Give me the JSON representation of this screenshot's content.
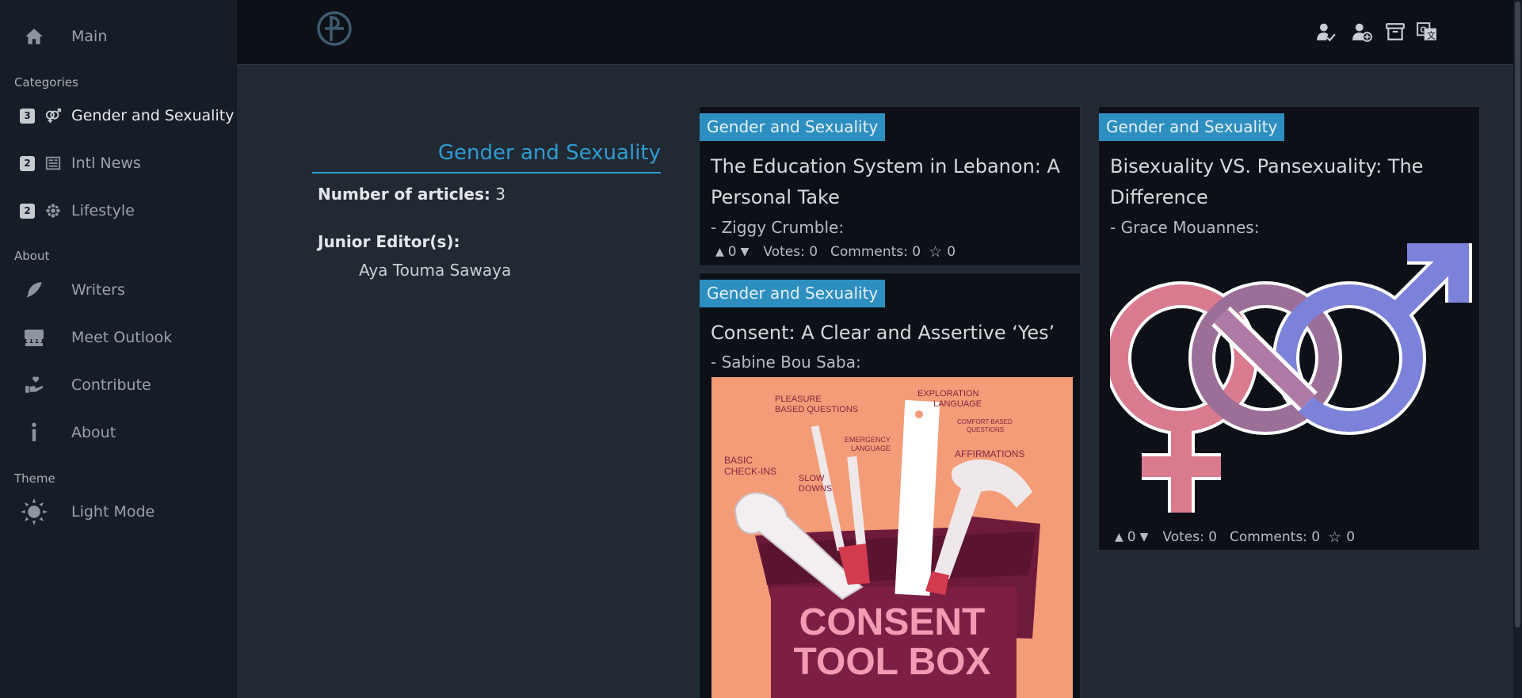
{
  "sidebar": {
    "main_label": "Main",
    "sections": {
      "categories": "Categories",
      "about": "About",
      "theme": "Theme"
    },
    "categories": [
      {
        "count": "3",
        "label": "Gender and Sexuality",
        "icon": "gender-icon"
      },
      {
        "count": "2",
        "label": "Intl News",
        "icon": "newspaper-icon"
      },
      {
        "count": "2",
        "label": "Lifestyle",
        "icon": "flower-icon"
      }
    ],
    "about_items": [
      {
        "label": "Writers",
        "icon": "feather-icon"
      },
      {
        "label": "Meet Outlook",
        "icon": "team-icon"
      },
      {
        "label": "Contribute",
        "icon": "hand-heart-icon"
      },
      {
        "label": "About",
        "icon": "info-icon"
      }
    ],
    "theme_label": "Light Mode"
  },
  "topbar": {
    "icons": [
      "user-check-icon",
      "user-plus-icon",
      "archive-icon",
      "translate-icon"
    ]
  },
  "category": {
    "title": "Gender and Sexuality",
    "articles_label": "Number of articles:",
    "articles_count": "3",
    "editor_label": "Junior Editor(s):",
    "editor_name": "Aya Touma Sawaya"
  },
  "articles": [
    {
      "tag": "Gender and Sexuality",
      "title_line1": "The Education System in Lebanon: A",
      "title_line2": "Personal Take",
      "author": "- Ziggy Crumble:",
      "up": "0",
      "votes": "Votes: 0",
      "comments": "Comments: 0",
      "stars": "0"
    },
    {
      "tag": "Gender and Sexuality",
      "title_line1": "Consent: A Clear and Assertive ‘Yes’",
      "author": "- Sabine Bou Saba:",
      "image": {
        "line1": "CONSENT",
        "line2": "TOOL BOX",
        "labels": [
          "PLEASURE",
          "BASED QUESTIONS",
          "EXPLORATION",
          "LANGUAGE",
          "COMFORT-BASED",
          "QUESTIONS",
          "EMERGENCY",
          "LANGUAGE",
          "BASIC",
          "CHECK-INS",
          "SLOW",
          "DOWNS",
          "AFFIRMATIONS"
        ]
      }
    },
    {
      "tag": "Gender and Sexuality",
      "title_line1": "Bisexuality VS. Pansexuality: The",
      "title_line2": "Difference",
      "author": "- Grace Mouannes:",
      "up": "0",
      "votes": "Votes: 0",
      "comments": "Comments: 0",
      "stars": "0"
    }
  ],
  "colors": {
    "accent": "#2f9bd1",
    "tag": "#2d8fc0",
    "card": "#0d1117",
    "sidebar": "#161d26"
  }
}
